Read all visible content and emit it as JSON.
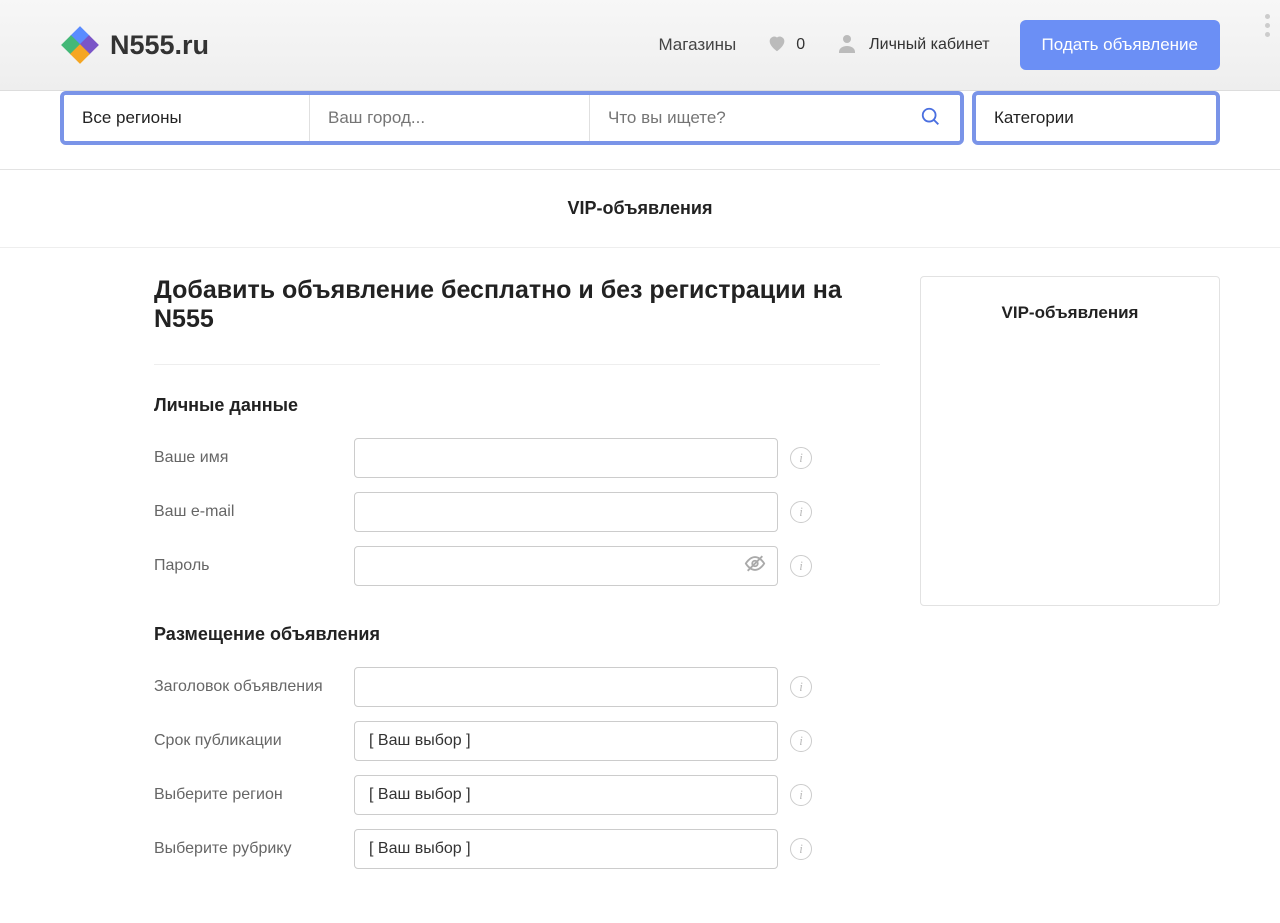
{
  "header": {
    "logo_text": "N555.ru",
    "nav_shops": "Магазины",
    "fav_count": "0",
    "account_label": "Личный кабинет",
    "post_button": "Подать объявление"
  },
  "search": {
    "regions": "Все регионы",
    "city_placeholder": "Ваш город...",
    "query_placeholder": "Что вы ищете?",
    "categories": "Категории"
  },
  "vip_strip": "VIP-объявления",
  "page": {
    "title": "Добавить объявление бесплатно и без регистрации на N555",
    "section_personal": "Личные данные",
    "section_placement": "Размещение объявления",
    "labels": {
      "name": "Ваше имя",
      "email": "Ваш e-mail",
      "password": "Пароль",
      "headline": "Заголовок объявления",
      "duration": "Срок публикации",
      "region": "Выберите регион",
      "category": "Выберите рубрику"
    },
    "select_placeholder": "[ Ваш выбор ]"
  },
  "sidebar": {
    "vip_title": "VIP-объявления"
  }
}
